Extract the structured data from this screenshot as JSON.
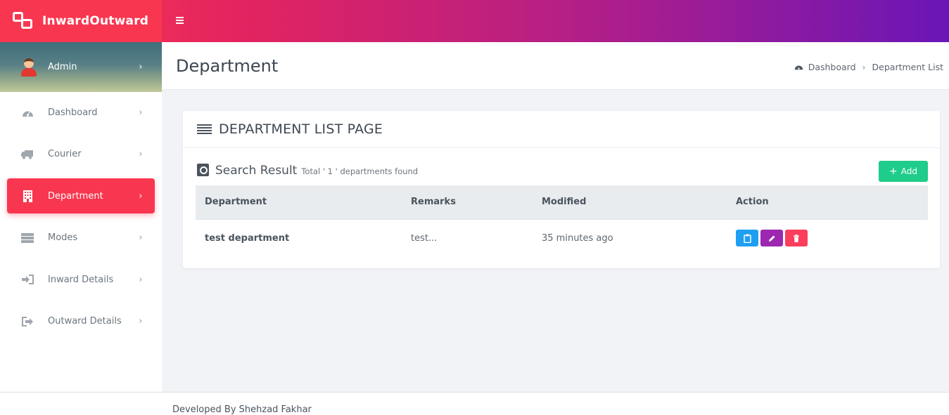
{
  "app": {
    "brand": "InwardOutward"
  },
  "user": {
    "name": "Admin"
  },
  "sidebar": {
    "items": [
      {
        "label": "Dashboard",
        "icon": "dashboard-icon",
        "active": false
      },
      {
        "label": "Courier",
        "icon": "truck-icon",
        "active": false
      },
      {
        "label": "Department",
        "icon": "building-icon",
        "active": true
      },
      {
        "label": "Modes",
        "icon": "server-icon",
        "active": false
      },
      {
        "label": "Inward Details",
        "icon": "sign-in-icon",
        "active": false
      },
      {
        "label": "Outward Details",
        "icon": "sign-out-icon",
        "active": false
      }
    ]
  },
  "header": {
    "title": "Department",
    "breadcrumb": {
      "home": "Dashboard",
      "current": "Department List"
    }
  },
  "card": {
    "title": "DEPARTMENT LIST PAGE",
    "search_title": "Search Result",
    "search_subtitle": "Total ' 1 ' departments found",
    "add_label": "Add"
  },
  "table": {
    "columns": [
      "Department",
      "Remarks",
      "Modified",
      "Action"
    ],
    "rows": [
      {
        "department": "test department",
        "remarks": "test...",
        "modified": "35 minutes ago"
      }
    ]
  },
  "footer": {
    "text": "Developed By Shehzad Fakhar"
  },
  "colors": {
    "accent": "#f9364f",
    "add": "#1fcc8a",
    "view": "#1e9ff2",
    "edit": "#9c27b0",
    "delete": "#fa3e5b"
  }
}
